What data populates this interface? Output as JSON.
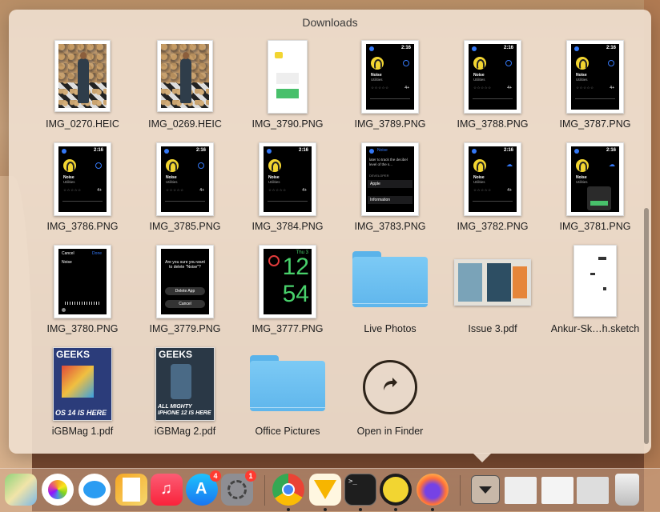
{
  "stack": {
    "title": "Downloads",
    "items": [
      {
        "label": "IMG_0270.HEIC"
      },
      {
        "label": "IMG_0269.HEIC"
      },
      {
        "label": "IMG_3790.PNG"
      },
      {
        "label": "IMG_3789.PNG"
      },
      {
        "label": "IMG_3788.PNG"
      },
      {
        "label": "IMG_3787.PNG"
      },
      {
        "label": "IMG_3786.PNG"
      },
      {
        "label": "IMG_3785.PNG"
      },
      {
        "label": "IMG_3784.PNG"
      },
      {
        "label": "IMG_3783.PNG"
      },
      {
        "label": "IMG_3782.PNG"
      },
      {
        "label": "IMG_3781.PNG"
      },
      {
        "label": "IMG_3780.PNG"
      },
      {
        "label": "IMG_3779.PNG"
      },
      {
        "label": "IMG_3777.PNG"
      },
      {
        "label": "Live Photos"
      },
      {
        "label": "Issue 3.pdf"
      },
      {
        "label": "Ankur-Sk…h.sketch"
      },
      {
        "label": "iGBMag 1.pdf"
      },
      {
        "label": "iGBMag 2.pdf"
      },
      {
        "label": "Office Pictures"
      },
      {
        "label": "Open in Finder"
      }
    ],
    "thumb_text": {
      "time": "2:16",
      "app_name": "Noise",
      "app_category": "Utilities",
      "ratings": "No Ratings",
      "age": "4+",
      "age_label": "Age",
      "cancel": "Cancel",
      "done": "Done",
      "delete_prompt": "Are you sure you want to delete \"Noise\"?",
      "delete_app": "Delete App",
      "cancel_btn": "Cancel",
      "clock_day": "Thu 3",
      "clock_hour": "12",
      "clock_min": "54",
      "settings_text": "later to track the decibel level of the s...",
      "developer": "DEVELOPER",
      "apple": "Apple",
      "information": "Information",
      "mag_title": "GEEKS",
      "mag1_headline": "OS 14 IS HERE",
      "mag2_headline": "ALL MIGHTY IPHONE 12 IS HERE"
    }
  },
  "dock": {
    "apps": [
      {
        "name": "Maps",
        "icon": "maps-icon"
      },
      {
        "name": "Photos",
        "icon": "photos-icon"
      },
      {
        "name": "Messages",
        "icon": "messages-icon"
      },
      {
        "name": "Pages",
        "icon": "pages-icon"
      },
      {
        "name": "Music",
        "icon": "music-icon"
      },
      {
        "name": "App Store",
        "icon": "app-store-icon",
        "badge": "4"
      },
      {
        "name": "System Preferences",
        "icon": "system-preferences-icon",
        "badge": "1"
      },
      {
        "name": "Chrome",
        "icon": "chrome-icon"
      },
      {
        "name": "Sketch",
        "icon": "sketch-icon"
      },
      {
        "name": "Terminal",
        "icon": "terminal-icon"
      },
      {
        "name": "Monitor",
        "icon": "monitor-app-icon"
      },
      {
        "name": "Firefox",
        "icon": "firefox-icon"
      },
      {
        "name": "Downloads",
        "icon": "downloads-stack-icon"
      },
      {
        "name": "Trash",
        "icon": "trash-icon"
      }
    ],
    "terminal_prompt": ">_"
  },
  "colors": {
    "stack_bg": "#eeded0",
    "folder_blue": "#6cbff0",
    "badge_red": "#ff3b30",
    "accent_blue": "#3478f6"
  }
}
